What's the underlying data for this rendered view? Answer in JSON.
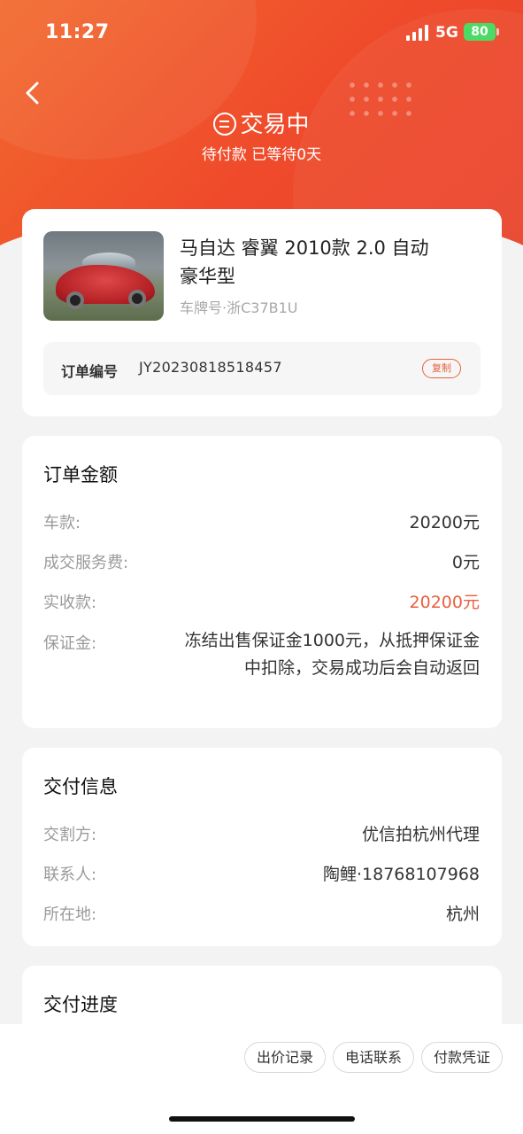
{
  "status_bar": {
    "time": "11:27",
    "network": "5G",
    "battery": "80"
  },
  "header": {
    "title": "交易中",
    "subtitle": "待付款 已等待0天"
  },
  "car": {
    "title": "马自达 睿翼 2010款 2.0 自动 豪华型",
    "plate": "车牌号·浙C37B1U",
    "order_label": "订单编号",
    "order_no": "JY20230818518457",
    "copy_label": "复制"
  },
  "amount": {
    "title": "订单金额",
    "rows": [
      {
        "label": "车款:",
        "value": "20200元"
      },
      {
        "label": "成交服务费:",
        "value": "0元"
      },
      {
        "label": "实收款:",
        "value": "20200元"
      }
    ],
    "deposit_label": "保证金:",
    "deposit_text": "冻结出售保证金1000元，从抵押保证金中扣除，交易成功后会自动返回"
  },
  "delivery": {
    "title": "交付信息",
    "rows": [
      {
        "label": "交割方:",
        "value": "优信拍杭州代理"
      },
      {
        "label": "联系人:",
        "value": "陶鲤·18768107968"
      },
      {
        "label": "所在地:",
        "value": "杭州"
      }
    ]
  },
  "progress": {
    "title": "交付进度"
  },
  "actions": [
    "出价记录",
    "电话联系",
    "付款凭证"
  ],
  "colors": {
    "accent": "#e8603d",
    "header": "#ef4a2b"
  }
}
